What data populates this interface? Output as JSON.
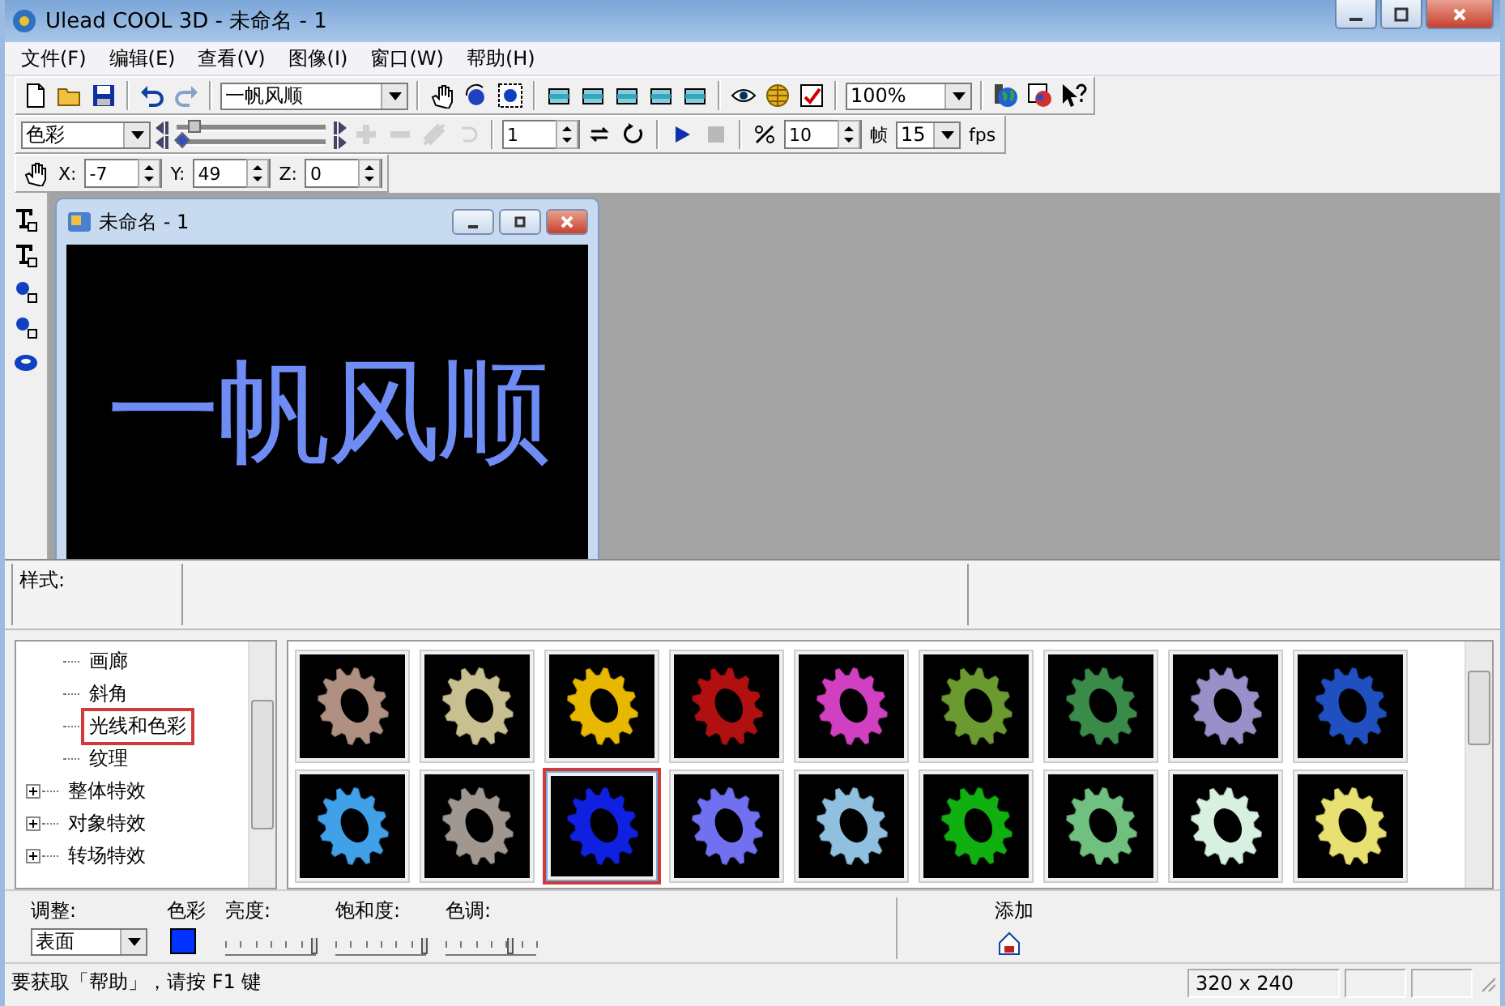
{
  "window": {
    "title": "Ulead COOL 3D - 未命名 - 1"
  },
  "menu": [
    "文件(F)",
    "编辑(E)",
    "查看(V)",
    "图像(I)",
    "窗口(W)",
    "帮助(H)"
  ],
  "toolbar_1": [
    {
      "kind": "button",
      "disabled": false
    },
    {
      "kind": "button",
      "disabled": false
    },
    {
      "kind": "button",
      "disabled": false
    },
    {
      "kind": "separator"
    },
    {
      "kind": "button",
      "disabled": false
    },
    {
      "kind": "button",
      "disabled": true
    },
    {
      "kind": "separator"
    },
    {
      "kind": "combo",
      "value": "一帆风顺"
    },
    {
      "kind": "separator"
    },
    {
      "kind": "button",
      "disabled": false
    },
    {
      "kind": "button",
      "disabled": false
    },
    {
      "kind": "button",
      "disabled": false
    },
    {
      "kind": "separator"
    },
    {
      "kind": "button",
      "disabled": false
    },
    {
      "kind": "button",
      "disabled": false
    },
    {
      "kind": "button",
      "disabled": false
    },
    {
      "kind": "button",
      "disabled": false
    },
    {
      "kind": "button",
      "disabled": false
    },
    {
      "kind": "separator"
    },
    {
      "kind": "button",
      "disabled": false
    },
    {
      "kind": "button",
      "disabled": false
    },
    {
      "kind": "button",
      "disabled": false
    },
    {
      "kind": "separator"
    },
    {
      "kind": "combo",
      "value": "100%"
    },
    {
      "kind": "separator"
    },
    {
      "kind": "button",
      "disabled": false
    },
    {
      "kind": "button",
      "disabled": false
    },
    {
      "kind": "button",
      "disabled": false
    }
  ],
  "toolbar_2": [
    {
      "kind": "combo",
      "value": "色彩"
    },
    {
      "kind": "sliders",
      "tracks": [
        {
          "level": 0.08
        },
        {
          "level": 0
        }
      ]
    },
    {
      "kind": "button",
      "disabled": true
    },
    {
      "kind": "button",
      "disabled": true
    },
    {
      "kind": "button",
      "disabled": true
    },
    {
      "kind": "button",
      "disabled": true
    },
    {
      "kind": "separator"
    },
    {
      "kind": "spin",
      "value": "1"
    },
    {
      "kind": "button",
      "disabled": false
    },
    {
      "kind": "button",
      "disabled": false
    },
    {
      "kind": "separator"
    },
    {
      "kind": "button",
      "disabled": false
    },
    {
      "kind": "button",
      "disabled": true
    },
    {
      "kind": "separator"
    },
    {
      "kind": "button",
      "disabled": false
    },
    {
      "kind": "spin",
      "value": "10"
    },
    {
      "kind": "label",
      "text": "帧"
    },
    {
      "kind": "combo",
      "value": "15"
    },
    {
      "kind": "label",
      "text": "fps"
    }
  ],
  "toolbar_3": [
    {
      "kind": "button",
      "disabled": false
    },
    {
      "kind": "label",
      "text": "X:"
    },
    {
      "kind": "spin",
      "value": "-7"
    },
    {
      "kind": "label",
      "text": "Y:"
    },
    {
      "kind": "spin",
      "value": "49"
    },
    {
      "kind": "label",
      "text": "Z:"
    },
    {
      "kind": "spin",
      "value": "0"
    }
  ],
  "document": {
    "title": "未命名 - 1",
    "text": "一帆风顺"
  },
  "style_bar": {
    "label": "样式:"
  },
  "tree": [
    {
      "label": "画廊",
      "kind": "leaf",
      "selected": false
    },
    {
      "label": "斜角",
      "kind": "leaf",
      "selected": false
    },
    {
      "label": "光线和色彩",
      "kind": "leaf",
      "selected": true
    },
    {
      "label": "纹理",
      "kind": "leaf",
      "selected": false
    },
    {
      "label": "整体特效",
      "kind": "folder",
      "expanded": false,
      "selected": false
    },
    {
      "label": "对象特效",
      "kind": "folder",
      "expanded": false,
      "selected": false
    },
    {
      "label": "转场特效",
      "kind": "folder",
      "expanded": false,
      "selected": false
    }
  ],
  "gallery": [
    {
      "color": "#b09080",
      "selected": false
    },
    {
      "color": "#c8c090",
      "selected": false
    },
    {
      "color": "#e8b800",
      "selected": false
    },
    {
      "color": "#b01010",
      "selected": false
    },
    {
      "color": "#d040c0",
      "selected": false
    },
    {
      "color": "#6a9a30",
      "selected": false
    },
    {
      "color": "#3a8a4a",
      "selected": false
    },
    {
      "color": "#9890c8",
      "selected": false
    },
    {
      "color": "#2050c0",
      "selected": false
    },
    {
      "color": "#40a0e8",
      "selected": false
    },
    {
      "color": "#a09890",
      "selected": false
    },
    {
      "color": "#1020e0",
      "selected": true
    },
    {
      "color": "#7070f0",
      "selected": false
    },
    {
      "color": "#90c0e0",
      "selected": false
    },
    {
      "color": "#10b010",
      "selected": false
    },
    {
      "color": "#70c080",
      "selected": false
    },
    {
      "color": "#d8f0e0",
      "selected": false
    },
    {
      "color": "#e8e070",
      "selected": false
    }
  ],
  "adjust": {
    "label": "调整:",
    "mode": "表面",
    "color_label": "色彩",
    "color": "#0033ff",
    "sliders": [
      {
        "label": "亮度:",
        "level": 0.95
      },
      {
        "label": "饱和度:",
        "level": 0.95
      },
      {
        "label": "色调:",
        "level": 0.67
      }
    ],
    "add_label": "添加"
  },
  "status_bar": {
    "message": "要获取「帮助」，请按 F1 键",
    "size": "320 x 240"
  }
}
